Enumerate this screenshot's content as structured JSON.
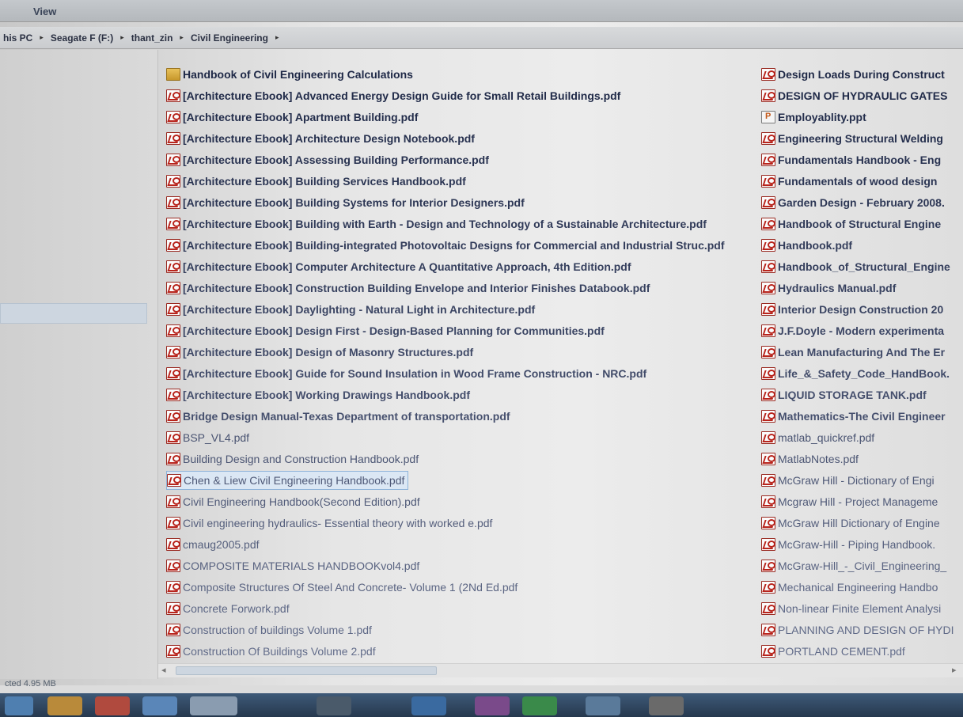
{
  "menubar": {
    "view_label": "View"
  },
  "address": {
    "crumbs": [
      "his PC",
      "Seagate F (F:)",
      "thant_zin",
      "Civil Engineering"
    ],
    "separator": "▸"
  },
  "status": {
    "text": "cted  4.95 MB"
  },
  "files": {
    "column1": [
      {
        "name": "Handbook of Civil Engineering Calculations",
        "icon": "folder-icon"
      },
      {
        "name": "[Architecture Ebook] Advanced Energy Design Guide for Small Retail Buildings.pdf",
        "icon": "pdf-icon"
      },
      {
        "name": "[Architecture Ebook] Apartment Building.pdf",
        "icon": "pdf-icon"
      },
      {
        "name": "[Architecture Ebook] Architecture Design Notebook.pdf",
        "icon": "pdf-icon"
      },
      {
        "name": "[Architecture Ebook] Assessing Building Performance.pdf",
        "icon": "pdf-icon"
      },
      {
        "name": "[Architecture Ebook] Building Services Handbook.pdf",
        "icon": "pdf-icon"
      },
      {
        "name": "[Architecture Ebook] Building Systems for Interior Designers.pdf",
        "icon": "pdf-icon"
      },
      {
        "name": "[Architecture Ebook] Building with Earth - Design and Technology of a Sustainable Architecture.pdf",
        "icon": "pdf-icon"
      },
      {
        "name": "[Architecture Ebook] Building-integrated Photovoltaic Designs for Commercial and Industrial Struc.pdf",
        "icon": "pdf-icon"
      },
      {
        "name": "[Architecture Ebook] Computer Architecture A Quantitative Approach, 4th Edition.pdf",
        "icon": "pdf-icon"
      },
      {
        "name": "[Architecture Ebook] Construction Building Envelope and Interior Finishes Databook.pdf",
        "icon": "pdf-icon"
      },
      {
        "name": "[Architecture Ebook] Daylighting - Natural Light in Architecture.pdf",
        "icon": "pdf-icon"
      },
      {
        "name": "[Architecture Ebook] Design First - Design-Based Planning for Communities.pdf",
        "icon": "pdf-icon"
      },
      {
        "name": "[Architecture Ebook] Design of Masonry Structures.pdf",
        "icon": "pdf-icon"
      },
      {
        "name": "[Architecture Ebook] Guide for Sound Insulation in Wood Frame Construction - NRC.pdf",
        "icon": "pdf-icon"
      },
      {
        "name": "[Architecture Ebook] Working Drawings Handbook.pdf",
        "icon": "pdf-icon"
      },
      {
        "name": "Bridge Design Manual-Texas Department of transportation.pdf",
        "icon": "pdf-icon"
      },
      {
        "name": "BSP_VL4.pdf",
        "icon": "pdf-icon"
      },
      {
        "name": "Building Design and Construction Handbook.pdf",
        "icon": "pdf-icon"
      },
      {
        "name": "Chen & Liew Civil Engineering Handbook.pdf",
        "icon": "pdf-icon",
        "selected": true
      },
      {
        "name": "Civil Engineering Handbook(Second Edition).pdf",
        "icon": "pdf-icon"
      },
      {
        "name": "Civil engineering hydraulics- Essential theory with worked e.pdf",
        "icon": "pdf-icon"
      },
      {
        "name": "cmaug2005.pdf",
        "icon": "pdf-icon"
      },
      {
        "name": "COMPOSITE MATERIALS HANDBOOKvol4.pdf",
        "icon": "pdf-icon"
      },
      {
        "name": "Composite Structures Of Steel And Concrete- Volume 1 (2Nd Ed.pdf",
        "icon": "pdf-icon"
      },
      {
        "name": "Concrete Forwork.pdf",
        "icon": "pdf-icon"
      },
      {
        "name": "Construction of buildings Volume 1.pdf",
        "icon": "pdf-icon"
      },
      {
        "name": "Construction Of Buildings Volume 2.pdf",
        "icon": "pdf-icon"
      }
    ],
    "column2": [
      {
        "name": "Design Loads During Construct",
        "icon": "pdf-icon"
      },
      {
        "name": "DESIGN OF HYDRAULIC GATES",
        "icon": "pdf-icon"
      },
      {
        "name": "Employablity.ppt",
        "icon": "ppt-icon"
      },
      {
        "name": "Engineering Structural Welding",
        "icon": "pdf-icon"
      },
      {
        "name": "Fundamentals Handbook - Eng",
        "icon": "pdf-icon"
      },
      {
        "name": "Fundamentals of wood design",
        "icon": "pdf-icon"
      },
      {
        "name": "Garden Design - February 2008.",
        "icon": "pdf-icon"
      },
      {
        "name": "Handbook of Structural Engine",
        "icon": "pdf-icon"
      },
      {
        "name": "Handbook.pdf",
        "icon": "pdf-icon"
      },
      {
        "name": "Handbook_of_Structural_Engine",
        "icon": "pdf-icon"
      },
      {
        "name": "Hydraulics Manual.pdf",
        "icon": "pdf-icon"
      },
      {
        "name": "Interior Design Construction 20",
        "icon": "pdf-icon"
      },
      {
        "name": "J.F.Doyle - Modern experimenta",
        "icon": "pdf-icon"
      },
      {
        "name": "Lean Manufacturing And The Er",
        "icon": "pdf-icon"
      },
      {
        "name": "Life_&_Safety_Code_HandBook.",
        "icon": "pdf-icon"
      },
      {
        "name": "LIQUID STORAGE TANK.pdf",
        "icon": "pdf-icon"
      },
      {
        "name": "Mathematics-The Civil Engineer",
        "icon": "pdf-icon"
      },
      {
        "name": "matlab_quickref.pdf",
        "icon": "pdf-icon"
      },
      {
        "name": "MatlabNotes.pdf",
        "icon": "pdf-icon"
      },
      {
        "name": "McGraw Hill - Dictionary of Engi",
        "icon": "pdf-icon"
      },
      {
        "name": "Mcgraw Hill - Project Manageme",
        "icon": "pdf-icon"
      },
      {
        "name": "McGraw Hill Dictionary of Engine",
        "icon": "pdf-icon"
      },
      {
        "name": "McGraw-Hill - Piping Handbook.",
        "icon": "pdf-icon"
      },
      {
        "name": "McGraw-Hill_-_Civil_Engineering_",
        "icon": "pdf-icon"
      },
      {
        "name": "Mechanical Engineering Handbo",
        "icon": "pdf-icon"
      },
      {
        "name": "Non-linear Finite Element Analysi",
        "icon": "pdf-icon"
      },
      {
        "name": "PLANNING AND DESIGN OF HYDI",
        "icon": "pdf-icon"
      },
      {
        "name": "PORTLAND CEMENT.pdf",
        "icon": "pdf-icon"
      }
    ]
  }
}
